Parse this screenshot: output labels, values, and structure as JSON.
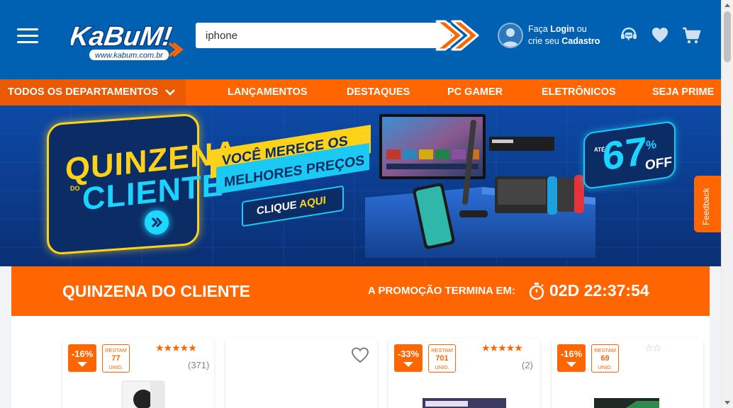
{
  "header": {
    "logo_text": "KaBuM!",
    "logo_url_text": "www.kabum.com.br",
    "search": {
      "value": "iphone",
      "placeholder": ""
    },
    "user": {
      "line1_prefix": "Faça ",
      "login_label": "Login",
      "line1_suffix": " ou",
      "line2_prefix": "crie seu ",
      "signup_label": "Cadastro"
    },
    "icons": [
      "menu-icon",
      "search-arrow-icon",
      "user-avatar-icon",
      "support-chat-icon",
      "heart-icon",
      "cart-icon"
    ],
    "colors": {
      "header_bg": "#0060b1",
      "accent": "#ff6500"
    }
  },
  "nav": {
    "departments_label": "TODOS OS DEPARTAMENTOS",
    "links": [
      "LANÇAMENTOS",
      "DESTAQUES",
      "PC GAMER",
      "ELETRÔNICOS",
      "SEJA PRIME"
    ]
  },
  "banner": {
    "title_line1": "QUINZENA",
    "title_do": "DO",
    "title_line2": "CLIENTE",
    "headline_line1": "VOCÊ MERECE OS",
    "headline_line2": "MELHORES PREÇOS",
    "cta_prefix": "CLIQUE ",
    "cta_highlight": "AQUI",
    "discount_prefix": "ATÉ",
    "discount_value": "67",
    "discount_sign": "%",
    "discount_suffix": "OFF"
  },
  "feedback_label": "Feedback",
  "promo": {
    "title": "QUINZENA DO CLIENTE",
    "ends_label": "A PROMOÇÃO TERMINA EM:",
    "timer": "02D 22:37:54"
  },
  "products": [
    {
      "discount": "-16%",
      "stock_label_top": "RESTAM",
      "stock": "77",
      "stock_label_bottom": "UNID.",
      "rating_stars": 5,
      "reviews": "(371)"
    },
    {
      "discount": "",
      "stock": "",
      "rating_stars": 0,
      "reviews": "",
      "favorite_icon": "heart-outline-icon"
    },
    {
      "discount": "-33%",
      "stock_label_top": "RESTAM",
      "stock": "701",
      "stock_label_bottom": "UNID.",
      "rating_stars": 5,
      "reviews": "(2)"
    },
    {
      "discount": "-16%",
      "stock_label_top": "RESTAM",
      "stock": "69",
      "stock_label_bottom": "UNID.",
      "rating_stars": 0,
      "reviews": ""
    }
  ]
}
